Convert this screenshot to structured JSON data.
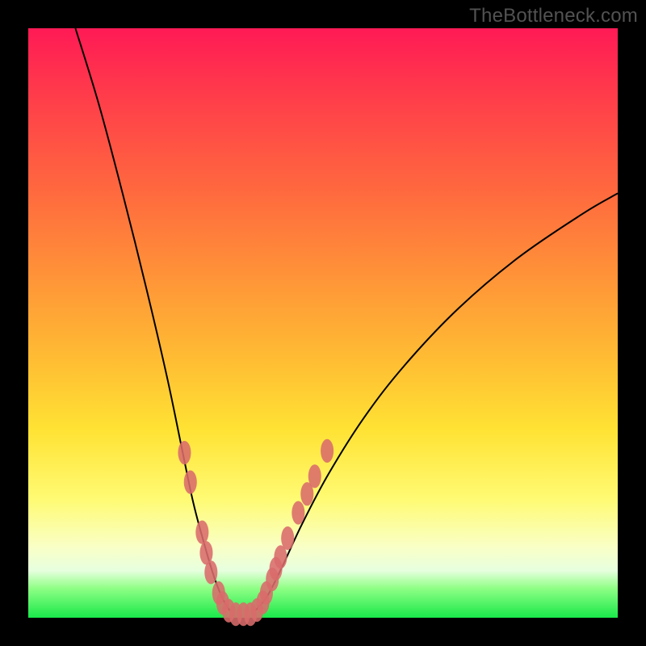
{
  "watermark": "TheBottleneck.com",
  "chart_data": {
    "type": "line",
    "title": "",
    "xlabel": "",
    "ylabel": "",
    "xlim": [
      0,
      100
    ],
    "ylim": [
      0,
      100
    ],
    "grid": false,
    "series": [
      {
        "name": "curve-left",
        "stroke": "#000000",
        "x": [
          8,
          12,
          16,
          20,
          23.5,
          26,
          28,
          30,
          31.5,
          33,
          34.2
        ],
        "y": [
          100,
          87,
          72,
          56,
          41,
          29,
          19.5,
          12,
          7,
          3.2,
          1.2
        ]
      },
      {
        "name": "curve-right",
        "stroke": "#000000",
        "x": [
          38.5,
          40.5,
          43,
          46.5,
          51,
          57,
          64,
          73,
          83,
          94,
          100
        ],
        "y": [
          1.2,
          3.6,
          8.5,
          16,
          24.5,
          34,
          43,
          52.5,
          61,
          68.5,
          72
        ]
      },
      {
        "name": "blob-markers",
        "stroke": "#d96b6b",
        "ry": 2.0,
        "rx": 1.1,
        "points": [
          {
            "x": 26.5,
            "y": 28
          },
          {
            "x": 27.5,
            "y": 23
          },
          {
            "x": 29.5,
            "y": 14.5
          },
          {
            "x": 30.2,
            "y": 11
          },
          {
            "x": 31.0,
            "y": 7.7
          },
          {
            "x": 32.3,
            "y": 4.2
          },
          {
            "x": 33.0,
            "y": 2.5
          },
          {
            "x": 34.0,
            "y": 1.2
          },
          {
            "x": 35.2,
            "y": 0.6
          },
          {
            "x": 36.5,
            "y": 0.6
          },
          {
            "x": 37.7,
            "y": 0.6
          },
          {
            "x": 38.8,
            "y": 1.3
          },
          {
            "x": 39.8,
            "y": 2.6
          },
          {
            "x": 40.4,
            "y": 4.2
          },
          {
            "x": 41.4,
            "y": 6.5
          },
          {
            "x": 42.0,
            "y": 8.3
          },
          {
            "x": 42.8,
            "y": 10.3
          },
          {
            "x": 44.0,
            "y": 13.5
          },
          {
            "x": 45.8,
            "y": 17.8
          },
          {
            "x": 47.3,
            "y": 21
          },
          {
            "x": 48.6,
            "y": 24
          },
          {
            "x": 50.7,
            "y": 28.3
          }
        ]
      }
    ]
  },
  "colors": {
    "frame": "#000000",
    "curve": "#000000",
    "marker": "#d96b6b"
  }
}
